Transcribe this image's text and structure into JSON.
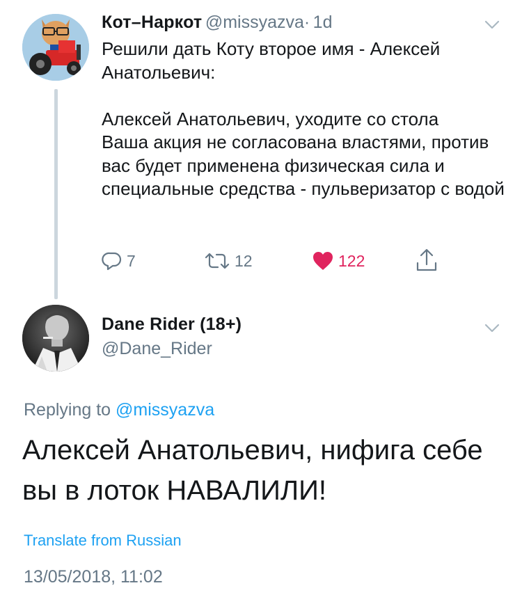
{
  "tweet1": {
    "author_name": "Кот–Наркот",
    "handle": "@missyazva",
    "separator": "·",
    "time": "1d",
    "text": "Решили дать Коту второе имя - Алексей Анатольевич:\n\nАлексей Анатольевич, уходите со стола\nВаша акция не согласована властями, против вас будет применена физическая сила и специальные средства - пульверизатор с водой",
    "replies": "7",
    "retweets": "12",
    "likes": "122",
    "avatar_icon": "tractor-avatar-icon"
  },
  "tweet2": {
    "author_name": "Dane Rider (18+)",
    "handle": "@Dane_Rider",
    "replying_prefix": "Replying to",
    "replying_handle": "@missyazva",
    "text": "Алексей Анатольевич, нифига себе вы в лоток НАВАЛИЛИ!",
    "translate_label": "Translate from Russian",
    "timestamp": "13/05/2018, 11:02",
    "avatar_icon": "smoking-man-avatar-icon"
  },
  "colors": {
    "accent": "#1da1f2",
    "like": "#e0245e",
    "muted": "#657786",
    "thread_line": "#ccd6dd"
  }
}
